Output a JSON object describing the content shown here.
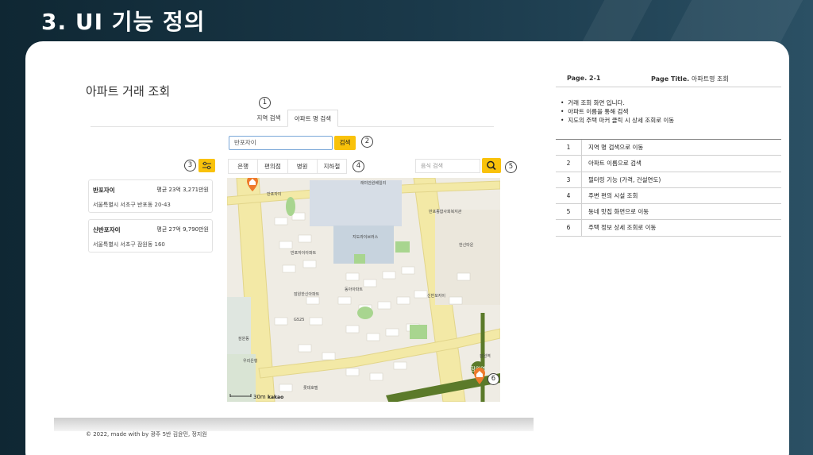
{
  "slide": {
    "title": "3. UI 기능 정의"
  },
  "app": {
    "page_title": "아파트 거래 조회",
    "tabs": [
      {
        "label": "지역 검색"
      },
      {
        "label": "아파트 명 검색"
      }
    ],
    "search": {
      "value": "반포자이",
      "button_label": "검색"
    },
    "categories": [
      {
        "label": "은행"
      },
      {
        "label": "편의점"
      },
      {
        "label": "병원"
      },
      {
        "label": "지하철"
      }
    ],
    "food_search": {
      "placeholder": "음식 검색"
    },
    "apartments": [
      {
        "name": "반포자이",
        "price": "평균 23억 3,271만원",
        "address": "서울특별시 서초구 반포동 20-43"
      },
      {
        "name": "신반포자이",
        "price": "평균 27억 9,790만원",
        "address": "서울특별시 서초구 잠원동 160"
      }
    ],
    "map": {
      "labels": {
        "bld_a": "반포자이",
        "bld_b": "반포자이아파트",
        "bld_c": "래미안원베일리",
        "bld_d": "반포종합사회복지관",
        "bld_e": "지도라이브러스",
        "bld_f": "잠원한신아파트",
        "bld_g": "동아아파트",
        "bld_h": "신반포자이",
        "bld_i": "G525",
        "bld_j": "잠원동",
        "bld_k": "우리은행",
        "bld_l": "한신타운",
        "bld_m": "잠원역",
        "bld_n": "롯데호텔",
        "station": "잠원역"
      },
      "scale_label": "30m",
      "brand": "kakao"
    },
    "footer": "© 2022, made with by 광주 5반 김윤민, 정지원"
  },
  "markers": [
    "1",
    "2",
    "3",
    "4",
    "5",
    "6"
  ],
  "spec": {
    "page": "Page. 2-1",
    "page_title_label": "Page Title.",
    "page_title_value": "아파트명  조회",
    "bullets": [
      "거래 조회 화면 입니다.",
      "아파트 이름을 통해 검색",
      "지도의 주택 마커 클릭 시 상세 조회로 이동"
    ],
    "rows": [
      {
        "n": "1",
        "desc": "지역 명 검색으로 이동"
      },
      {
        "n": "2",
        "desc": "아파트 이름으로 검색"
      },
      {
        "n": "3",
        "desc": "필터링 기능 (가격, 건설연도)"
      },
      {
        "n": "4",
        "desc": "주변 편의 시설 조회"
      },
      {
        "n": "5",
        "desc": "동네 맛집 화면으로 이동"
      },
      {
        "n": "6",
        "desc": "주택 정보 상세 조회로 이동"
      }
    ]
  },
  "colors": {
    "accent": "#f9c20a",
    "input_border": "#7aa7d8",
    "road": "#f3e9a6",
    "subway": "#5b7a2a"
  }
}
